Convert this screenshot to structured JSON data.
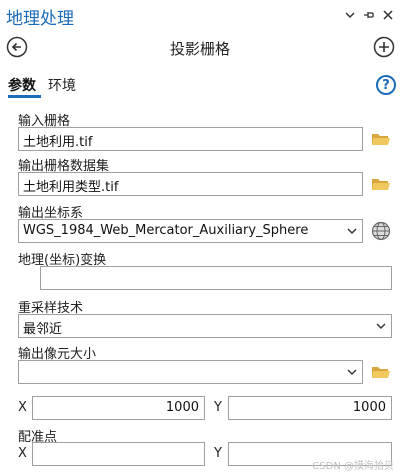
{
  "pane": {
    "title": "地理处理"
  },
  "tool": {
    "title": "投影栅格"
  },
  "tabs": [
    {
      "label": "参数"
    },
    {
      "label": "环境"
    }
  ],
  "params": {
    "input_raster": {
      "label": "输入栅格",
      "value": "土地利用.tif"
    },
    "output_dataset": {
      "label": "输出栅格数据集",
      "value": "土地利用类型.tif"
    },
    "output_crs": {
      "label": "输出坐标系",
      "value": "WGS_1984_Web_Mercator_Auxiliary_Sphere"
    },
    "geo_transform": {
      "label": "地理(坐标)变换",
      "value": ""
    },
    "resampling": {
      "label": "重采样技术",
      "value": "最邻近"
    },
    "cell_size": {
      "label": "输出像元大小",
      "value": "",
      "x_label": "X",
      "y_label": "Y",
      "x_value": "1000",
      "y_value": "1000"
    },
    "registration": {
      "label": "配准点",
      "x_label": "X",
      "y_label": "Y",
      "x_value": "",
      "y_value": ""
    }
  },
  "watermark": "CSDN @摸海拾贝",
  "colors": {
    "accent": "#1a6bb8",
    "folder": "#e8b84a"
  }
}
